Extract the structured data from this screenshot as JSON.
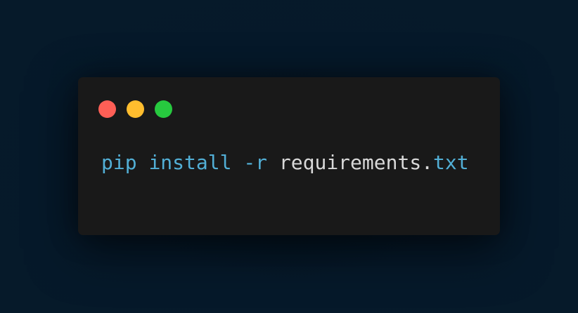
{
  "window": {
    "controls": [
      {
        "name": "close",
        "color": "#ff5f56"
      },
      {
        "name": "minimize",
        "color": "#ffbd2e"
      },
      {
        "name": "maximize",
        "color": "#27c93f"
      }
    ]
  },
  "code": {
    "tokens": [
      {
        "text": "pip",
        "kind": "keyword"
      },
      {
        "text": " ",
        "kind": "space"
      },
      {
        "text": "install",
        "kind": "keyword"
      },
      {
        "text": " ",
        "kind": "space"
      },
      {
        "text": "-r",
        "kind": "keyword"
      },
      {
        "text": " ",
        "kind": "space"
      },
      {
        "text": "requirements.",
        "kind": "plain"
      },
      {
        "text": "txt",
        "kind": "keyword"
      }
    ]
  },
  "colors": {
    "background": "#061a2a",
    "terminal": "#191919",
    "keyword": "#52afd6",
    "plain": "#d9d9d9"
  }
}
